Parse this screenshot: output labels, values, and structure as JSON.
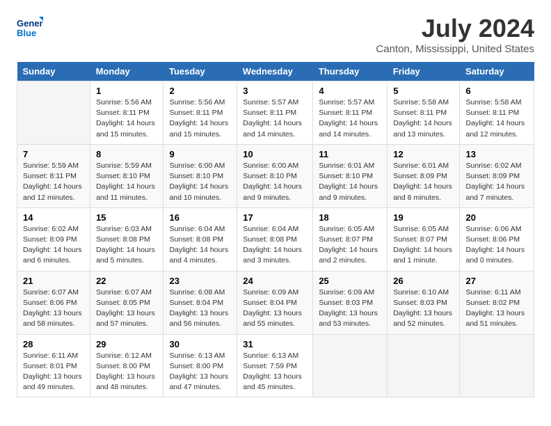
{
  "header": {
    "logo_line1": "General",
    "logo_line2": "Blue",
    "title": "July 2024",
    "subtitle": "Canton, Mississippi, United States"
  },
  "days_of_week": [
    "Sunday",
    "Monday",
    "Tuesday",
    "Wednesday",
    "Thursday",
    "Friday",
    "Saturday"
  ],
  "weeks": [
    [
      {
        "day": "",
        "sunrise": "",
        "sunset": "",
        "daylight": "",
        "empty": true
      },
      {
        "day": "1",
        "sunrise": "Sunrise: 5:56 AM",
        "sunset": "Sunset: 8:11 PM",
        "daylight": "Daylight: 14 hours and 15 minutes."
      },
      {
        "day": "2",
        "sunrise": "Sunrise: 5:56 AM",
        "sunset": "Sunset: 8:11 PM",
        "daylight": "Daylight: 14 hours and 15 minutes."
      },
      {
        "day": "3",
        "sunrise": "Sunrise: 5:57 AM",
        "sunset": "Sunset: 8:11 PM",
        "daylight": "Daylight: 14 hours and 14 minutes."
      },
      {
        "day": "4",
        "sunrise": "Sunrise: 5:57 AM",
        "sunset": "Sunset: 8:11 PM",
        "daylight": "Daylight: 14 hours and 14 minutes."
      },
      {
        "day": "5",
        "sunrise": "Sunrise: 5:58 AM",
        "sunset": "Sunset: 8:11 PM",
        "daylight": "Daylight: 14 hours and 13 minutes."
      },
      {
        "day": "6",
        "sunrise": "Sunrise: 5:58 AM",
        "sunset": "Sunset: 8:11 PM",
        "daylight": "Daylight: 14 hours and 12 minutes."
      }
    ],
    [
      {
        "day": "7",
        "sunrise": "Sunrise: 5:59 AM",
        "sunset": "Sunset: 8:11 PM",
        "daylight": "Daylight: 14 hours and 12 minutes."
      },
      {
        "day": "8",
        "sunrise": "Sunrise: 5:59 AM",
        "sunset": "Sunset: 8:10 PM",
        "daylight": "Daylight: 14 hours and 11 minutes."
      },
      {
        "day": "9",
        "sunrise": "Sunrise: 6:00 AM",
        "sunset": "Sunset: 8:10 PM",
        "daylight": "Daylight: 14 hours and 10 minutes."
      },
      {
        "day": "10",
        "sunrise": "Sunrise: 6:00 AM",
        "sunset": "Sunset: 8:10 PM",
        "daylight": "Daylight: 14 hours and 9 minutes."
      },
      {
        "day": "11",
        "sunrise": "Sunrise: 6:01 AM",
        "sunset": "Sunset: 8:10 PM",
        "daylight": "Daylight: 14 hours and 9 minutes."
      },
      {
        "day": "12",
        "sunrise": "Sunrise: 6:01 AM",
        "sunset": "Sunset: 8:09 PM",
        "daylight": "Daylight: 14 hours and 8 minutes."
      },
      {
        "day": "13",
        "sunrise": "Sunrise: 6:02 AM",
        "sunset": "Sunset: 8:09 PM",
        "daylight": "Daylight: 14 hours and 7 minutes."
      }
    ],
    [
      {
        "day": "14",
        "sunrise": "Sunrise: 6:02 AM",
        "sunset": "Sunset: 8:09 PM",
        "daylight": "Daylight: 14 hours and 6 minutes."
      },
      {
        "day": "15",
        "sunrise": "Sunrise: 6:03 AM",
        "sunset": "Sunset: 8:08 PM",
        "daylight": "Daylight: 14 hours and 5 minutes."
      },
      {
        "day": "16",
        "sunrise": "Sunrise: 6:04 AM",
        "sunset": "Sunset: 8:08 PM",
        "daylight": "Daylight: 14 hours and 4 minutes."
      },
      {
        "day": "17",
        "sunrise": "Sunrise: 6:04 AM",
        "sunset": "Sunset: 8:08 PM",
        "daylight": "Daylight: 14 hours and 3 minutes."
      },
      {
        "day": "18",
        "sunrise": "Sunrise: 6:05 AM",
        "sunset": "Sunset: 8:07 PM",
        "daylight": "Daylight: 14 hours and 2 minutes."
      },
      {
        "day": "19",
        "sunrise": "Sunrise: 6:05 AM",
        "sunset": "Sunset: 8:07 PM",
        "daylight": "Daylight: 14 hours and 1 minute."
      },
      {
        "day": "20",
        "sunrise": "Sunrise: 6:06 AM",
        "sunset": "Sunset: 8:06 PM",
        "daylight": "Daylight: 14 hours and 0 minutes."
      }
    ],
    [
      {
        "day": "21",
        "sunrise": "Sunrise: 6:07 AM",
        "sunset": "Sunset: 8:06 PM",
        "daylight": "Daylight: 13 hours and 58 minutes."
      },
      {
        "day": "22",
        "sunrise": "Sunrise: 6:07 AM",
        "sunset": "Sunset: 8:05 PM",
        "daylight": "Daylight: 13 hours and 57 minutes."
      },
      {
        "day": "23",
        "sunrise": "Sunrise: 6:08 AM",
        "sunset": "Sunset: 8:04 PM",
        "daylight": "Daylight: 13 hours and 56 minutes."
      },
      {
        "day": "24",
        "sunrise": "Sunrise: 6:09 AM",
        "sunset": "Sunset: 8:04 PM",
        "daylight": "Daylight: 13 hours and 55 minutes."
      },
      {
        "day": "25",
        "sunrise": "Sunrise: 6:09 AM",
        "sunset": "Sunset: 8:03 PM",
        "daylight": "Daylight: 13 hours and 53 minutes."
      },
      {
        "day": "26",
        "sunrise": "Sunrise: 6:10 AM",
        "sunset": "Sunset: 8:03 PM",
        "daylight": "Daylight: 13 hours and 52 minutes."
      },
      {
        "day": "27",
        "sunrise": "Sunrise: 6:11 AM",
        "sunset": "Sunset: 8:02 PM",
        "daylight": "Daylight: 13 hours and 51 minutes."
      }
    ],
    [
      {
        "day": "28",
        "sunrise": "Sunrise: 6:11 AM",
        "sunset": "Sunset: 8:01 PM",
        "daylight": "Daylight: 13 hours and 49 minutes."
      },
      {
        "day": "29",
        "sunrise": "Sunrise: 6:12 AM",
        "sunset": "Sunset: 8:00 PM",
        "daylight": "Daylight: 13 hours and 48 minutes."
      },
      {
        "day": "30",
        "sunrise": "Sunrise: 6:13 AM",
        "sunset": "Sunset: 8:00 PM",
        "daylight": "Daylight: 13 hours and 47 minutes."
      },
      {
        "day": "31",
        "sunrise": "Sunrise: 6:13 AM",
        "sunset": "Sunset: 7:59 PM",
        "daylight": "Daylight: 13 hours and 45 minutes."
      },
      {
        "day": "",
        "sunrise": "",
        "sunset": "",
        "daylight": "",
        "empty": true
      },
      {
        "day": "",
        "sunrise": "",
        "sunset": "",
        "daylight": "",
        "empty": true
      },
      {
        "day": "",
        "sunrise": "",
        "sunset": "",
        "daylight": "",
        "empty": true
      }
    ]
  ]
}
